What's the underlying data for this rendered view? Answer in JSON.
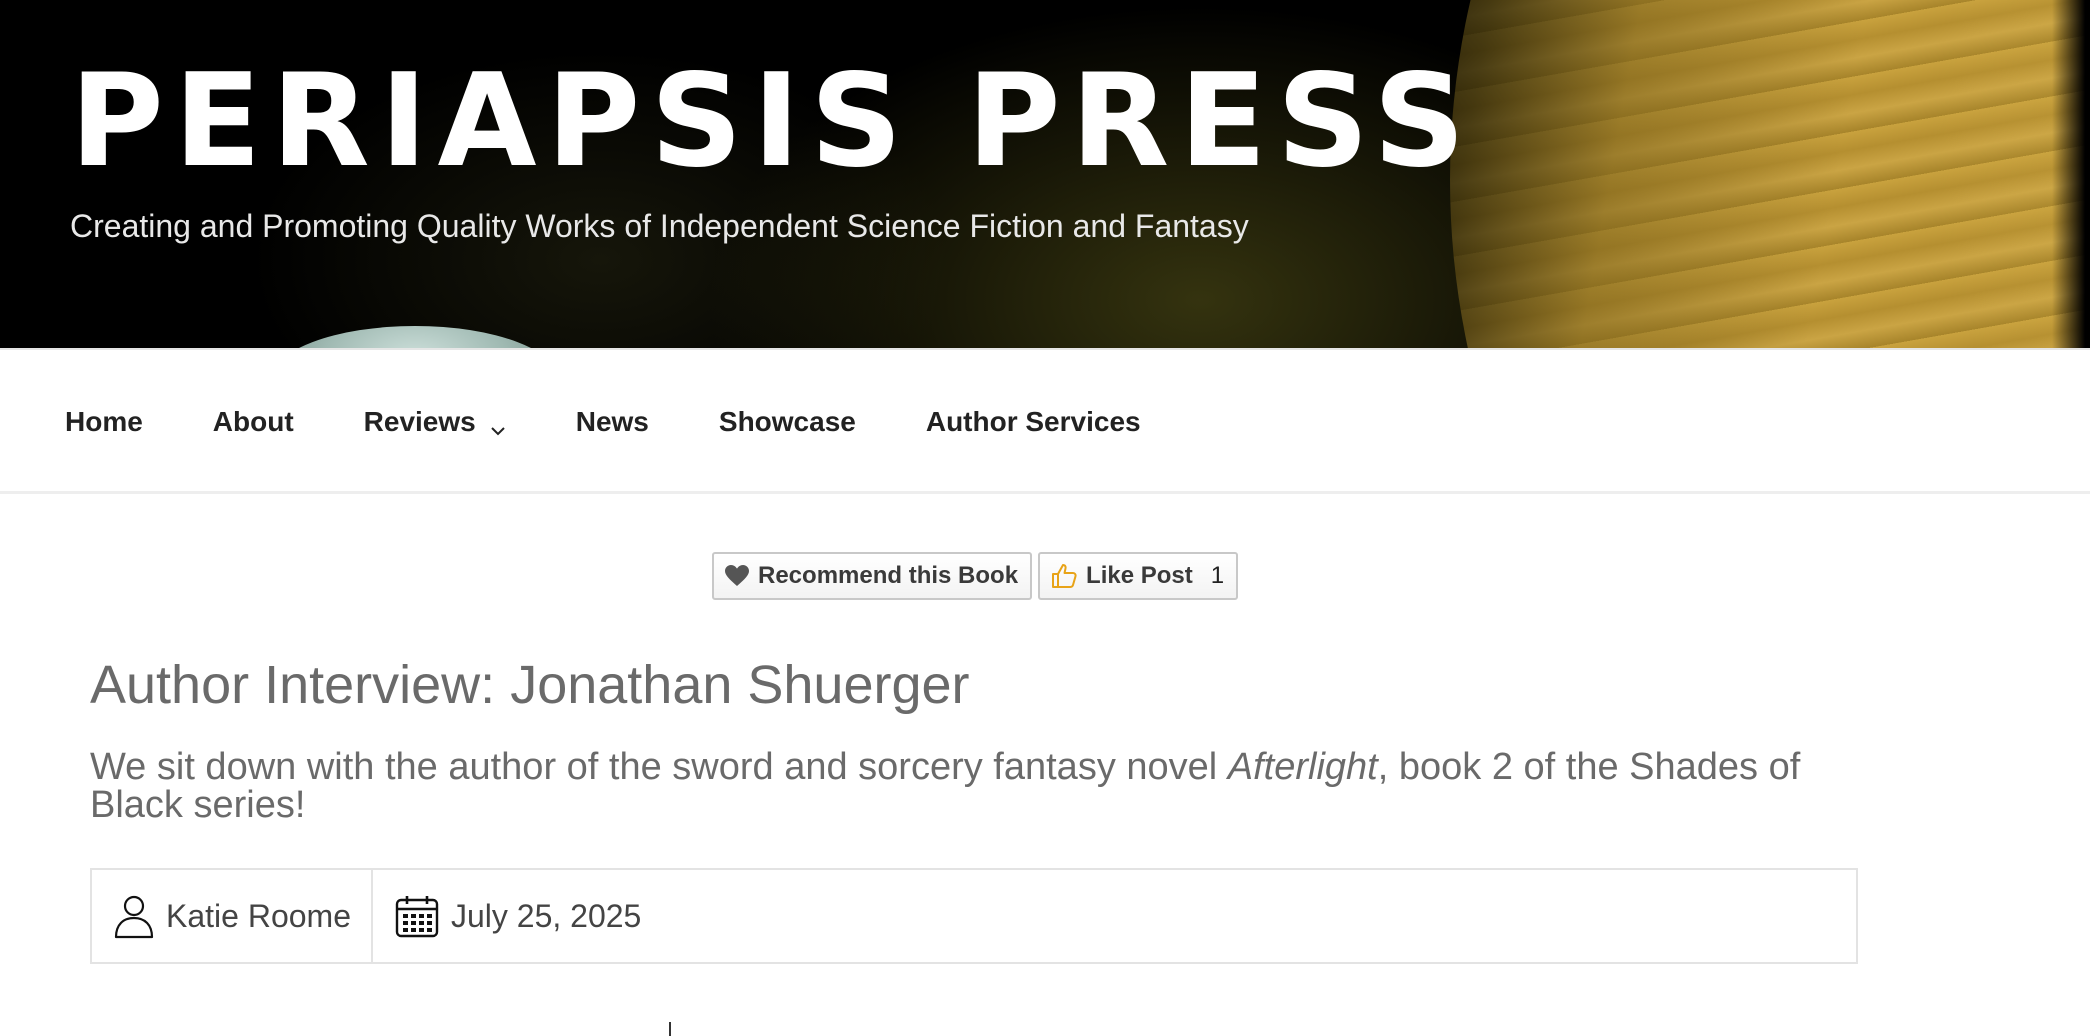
{
  "header": {
    "site_title": "PERIAPSIS PRESS",
    "tagline": "Creating and Promoting Quality Works of Independent Science Fiction and Fantasy"
  },
  "nav": {
    "items": [
      {
        "label": "Home"
      },
      {
        "label": "About"
      },
      {
        "label": "Reviews",
        "has_dropdown": true
      },
      {
        "label": "News"
      },
      {
        "label": "Showcase"
      },
      {
        "label": "Author Services"
      }
    ]
  },
  "actions": {
    "recommend_label": "Recommend this Book",
    "like_label": "Like Post",
    "like_count": "1"
  },
  "post": {
    "title": "Author Interview: Jonathan Shuerger",
    "subtitle_before": "We sit down with the author of the sword and sorcery fantasy novel ",
    "subtitle_book": "Afterlight",
    "subtitle_after": ", book 2 of the Shades of Black series!",
    "author": "Katie Roome",
    "date": "July 25, 2025"
  },
  "icons": {
    "nav_dropdown": "chevron-down-icon",
    "recommend": "heart-icon",
    "like": "thumbs-up-icon",
    "author": "user-icon",
    "date": "calendar-icon"
  },
  "colors": {
    "header_bg": "#000000",
    "title_text": "#ffffff",
    "nav_text": "#222222",
    "heading_text": "#6a6a6a",
    "like_icon": "#e8a317",
    "heart_icon": "#555555"
  }
}
